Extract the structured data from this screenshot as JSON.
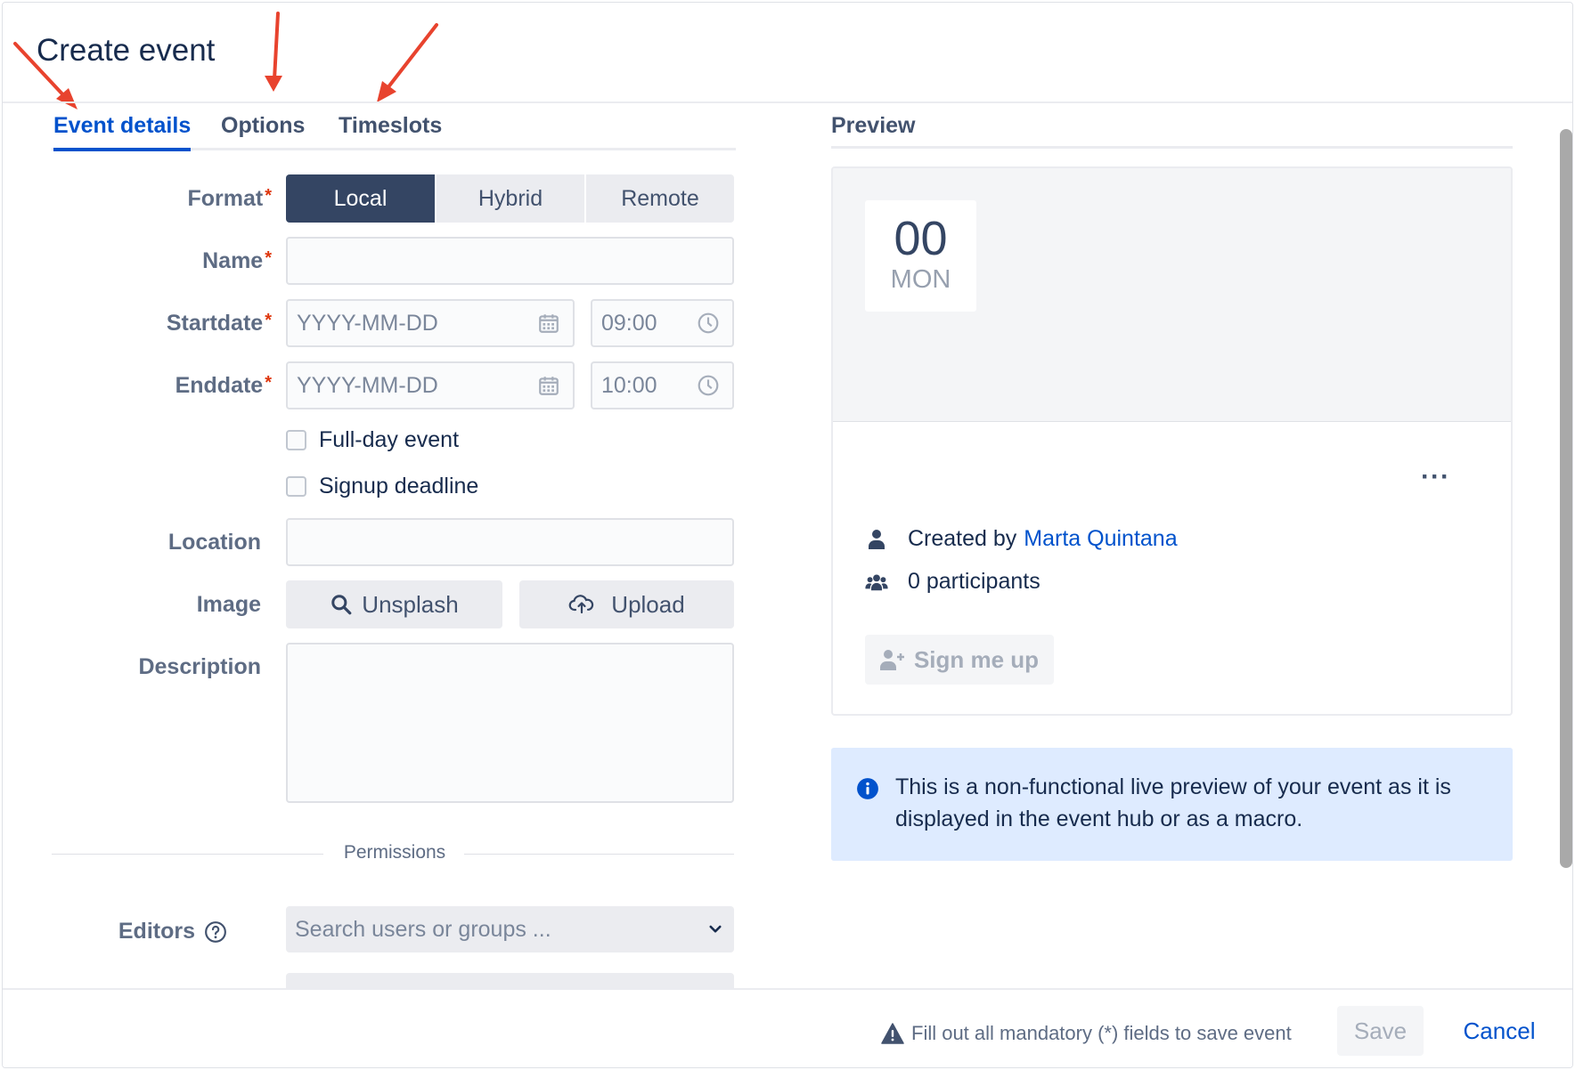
{
  "dialog": {
    "title": "Create event"
  },
  "tabs": [
    {
      "label": "Event details",
      "active": true
    },
    {
      "label": "Options",
      "active": false
    },
    {
      "label": "Timeslots",
      "active": false
    }
  ],
  "form": {
    "format": {
      "label": "Format",
      "options": [
        "Local",
        "Hybrid",
        "Remote"
      ],
      "selected": "Local"
    },
    "name": {
      "label": "Name",
      "value": ""
    },
    "startdate": {
      "label": "Startdate",
      "date_placeholder": "YYYY-MM-DD",
      "time": "09:00"
    },
    "enddate": {
      "label": "Enddate",
      "date_placeholder": "YYYY-MM-DD",
      "time": "10:00"
    },
    "full_day": {
      "label": "Full-day event",
      "checked": false
    },
    "signup_deadline": {
      "label": "Signup deadline",
      "checked": false
    },
    "location": {
      "label": "Location",
      "value": ""
    },
    "image": {
      "label": "Image",
      "unsplash_label": "Unsplash",
      "upload_label": "Upload"
    },
    "description": {
      "label": "Description",
      "value": ""
    },
    "permissions": {
      "section_label": "Permissions",
      "editors_label": "Editors",
      "editors_placeholder": "Search users or groups ..."
    }
  },
  "preview": {
    "title": "Preview",
    "date_day": "00",
    "date_weekday": "MON",
    "more_label": "···",
    "created_by_prefix": "Created by",
    "created_by_name": "Marta Quintana",
    "participants": "0 participants",
    "signup_label": "Sign me up",
    "info_text": "This is a non-functional live preview of your event as it is displayed in the event hub or as a macro."
  },
  "footer": {
    "warning": "Fill out all mandatory (*) fields to save event",
    "save_label": "Save",
    "cancel_label": "Cancel"
  },
  "colors": {
    "accent": "#0052cc",
    "selected_segment": "#344563",
    "required": "#de350b",
    "info_bg": "#deebff",
    "annotation_arrow": "#e8432e"
  }
}
